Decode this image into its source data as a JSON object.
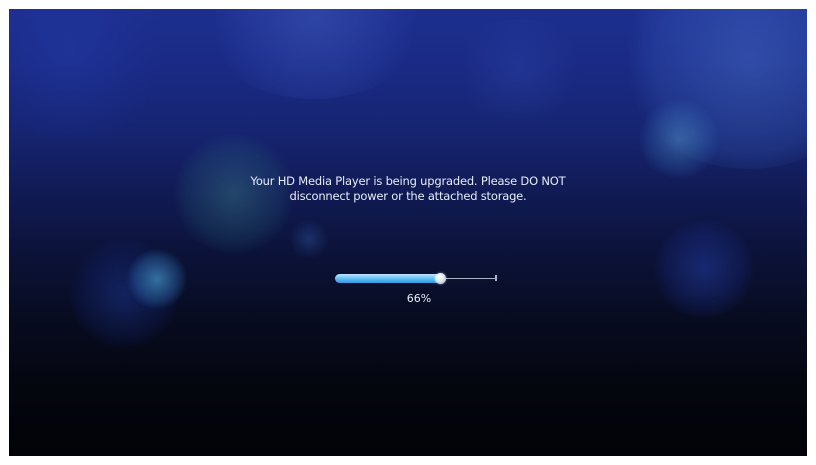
{
  "upgrade_screen": {
    "message_line1": "Your HD Media Player is being upgraded. Please DO NOT",
    "message_line2": "disconnect power or the attached storage.",
    "progress": {
      "value": 0.66,
      "label": "66%"
    }
  },
  "colors": {
    "background_top": "#1d2f8f",
    "background_bottom": "#020307",
    "progress_fill": "#4fb2ec",
    "text": "#e6ecf7"
  }
}
